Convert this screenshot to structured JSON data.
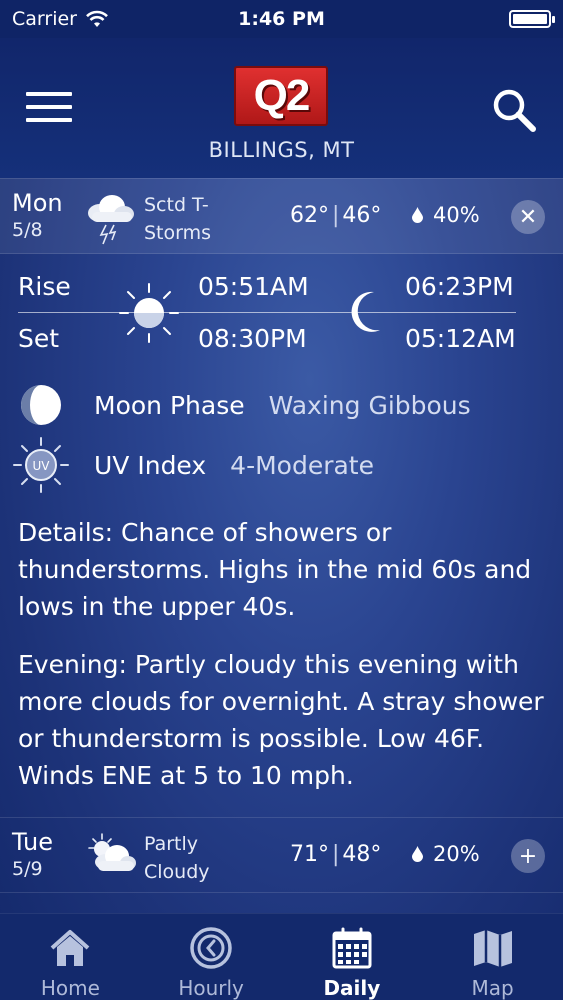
{
  "status_bar": {
    "carrier": "Carrier",
    "time": "1:46 PM"
  },
  "header": {
    "logo_text": "Q2",
    "location": "BILLINGS, MT"
  },
  "today": {
    "day": "Mon",
    "date": "5/8",
    "condition_line1": "Sctd T-",
    "condition_line2": "Storms",
    "high": "62°",
    "low": "46°",
    "precip": "40%",
    "icon": "thunderstorm-icon",
    "toggle": "✕"
  },
  "sun_moon": {
    "rise_label": "Rise",
    "set_label": "Set",
    "sunrise": "05:51AM",
    "sunset": "08:30PM",
    "moonrise": "06:23PM",
    "moonset": "05:12AM"
  },
  "moon_phase": {
    "label": "Moon Phase",
    "value": "Waxing Gibbous"
  },
  "uv_index": {
    "label": "UV Index",
    "value": "4-Moderate",
    "icon_text": "UV"
  },
  "details": {
    "day": "Details: Chance of showers or thunderstorms. Highs in the mid 60s and lows in the upper 40s.",
    "evening": "Evening: Partly cloudy this evening with more clouds for overnight. A stray shower or thunderstorm is possible. Low 46F. Winds ENE at 5 to 10 mph."
  },
  "tomorrow": {
    "day": "Tue",
    "date": "5/9",
    "condition_line1": "Partly",
    "condition_line2": "Cloudy",
    "high": "71°",
    "low": "48°",
    "precip": "20%",
    "icon": "partly-cloudy-icon",
    "toggle": "+"
  },
  "tabs": [
    {
      "label": "Home",
      "icon": "home-icon"
    },
    {
      "label": "Hourly",
      "icon": "clock-icon"
    },
    {
      "label": "Daily",
      "icon": "calendar-icon",
      "active": true
    },
    {
      "label": "Map",
      "icon": "map-icon"
    }
  ],
  "colors": {
    "background": "#1d3379",
    "header": "#11266b",
    "tabbar": "#13296c",
    "logo_red": "#d42424"
  }
}
